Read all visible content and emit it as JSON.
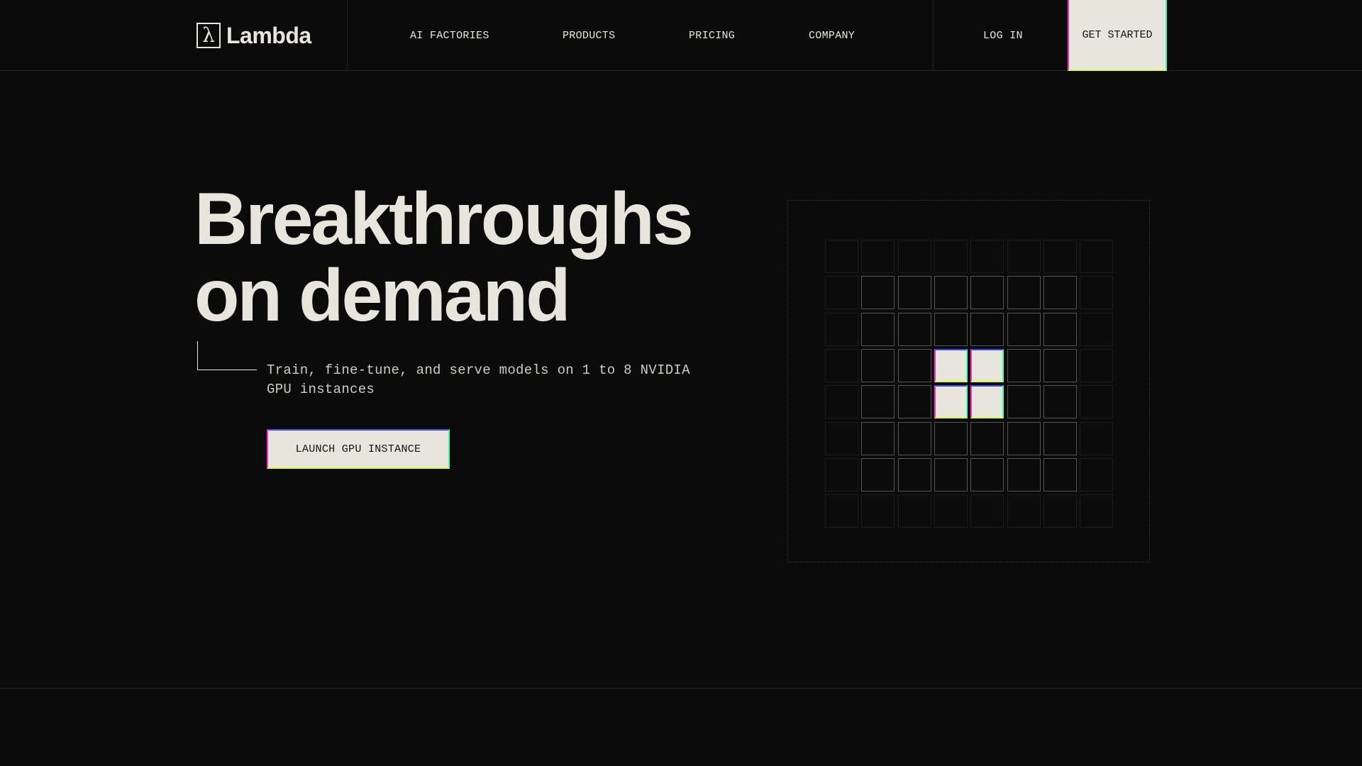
{
  "nav": {
    "logo_text": "Lambda",
    "logo_glyph": "λ",
    "items": [
      {
        "label": "AI FACTORIES"
      },
      {
        "label": "PRODUCTS"
      },
      {
        "label": "PRICING"
      },
      {
        "label": "COMPANY"
      }
    ],
    "login_label": "LOG IN",
    "get_started_label": "GET STARTED"
  },
  "hero": {
    "title_line1": "Breakthroughs",
    "title_line2": "on demand",
    "subtitle": "Train, fine-tune, and serve models on 1 to 8 NVIDIA GPU instances",
    "cta_label": "LAUNCH GPU INSTANCE"
  },
  "colors": {
    "background": "#0b0b0b",
    "foreground": "#e8e6dc",
    "accent_magenta": "#ff2ad1",
    "accent_green": "#3cffb0",
    "accent_blue": "#3a4cff",
    "accent_yellow": "#d9ff3c"
  },
  "grid_visual": {
    "lit_cells": [
      [
        3,
        3
      ],
      [
        3,
        4
      ],
      [
        4,
        3
      ],
      [
        4,
        4
      ]
    ]
  }
}
